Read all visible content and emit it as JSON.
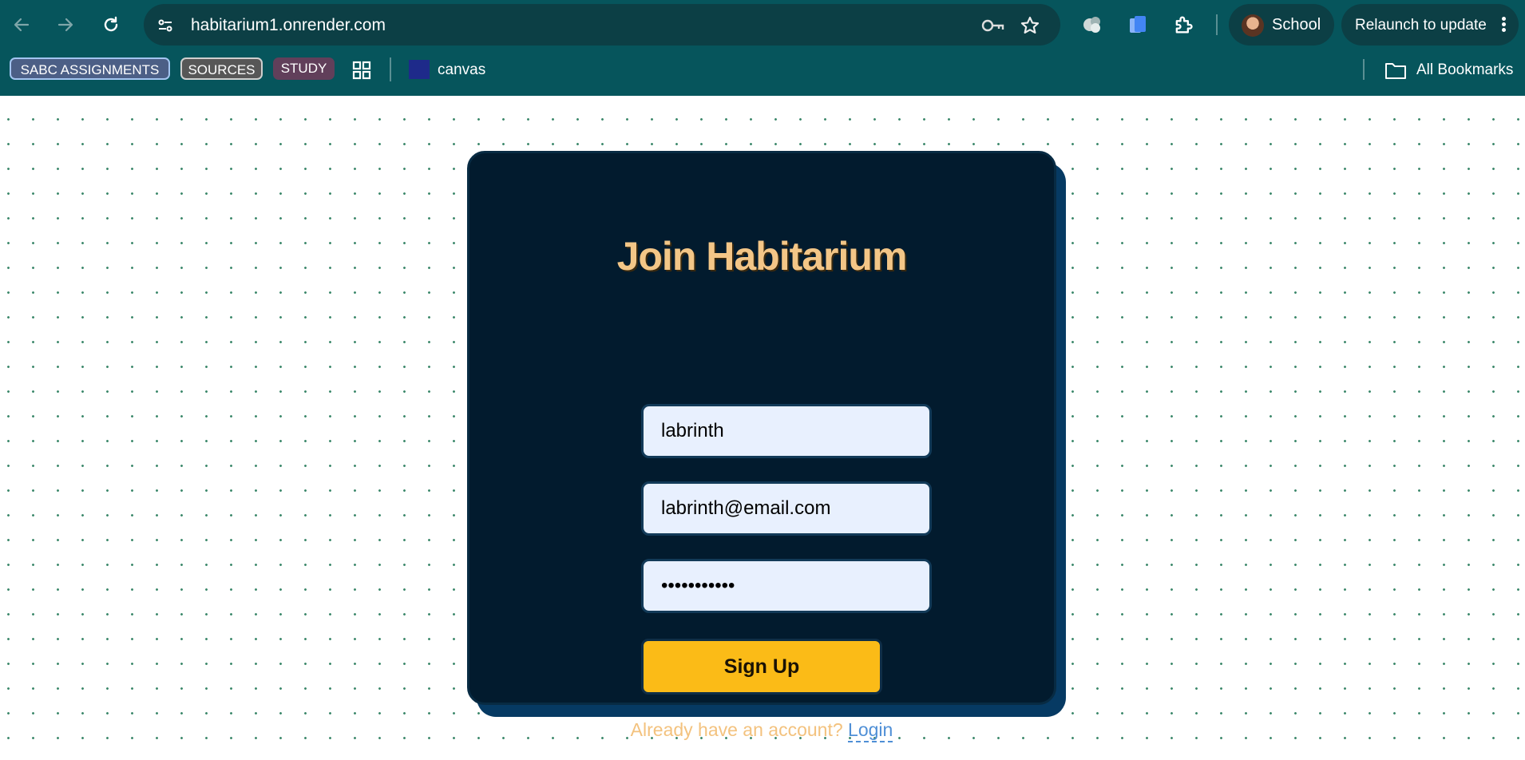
{
  "browser": {
    "url": "habitarium1.onrender.com",
    "profile_label": "School",
    "relaunch_label": "Relaunch to update",
    "icons": [
      "back-arrow-icon",
      "forward-arrow-icon",
      "reload-icon",
      "site-info-icon",
      "key-icon",
      "star-icon",
      "extension-puzzle-icon",
      "clipboard-icon",
      "extensions-icon",
      "more-vert-icon"
    ]
  },
  "bookmarks": {
    "items": [
      {
        "label": "SABC ASSIGNMENTS"
      },
      {
        "label": "SOURCES"
      },
      {
        "label": "STUDY"
      },
      {
        "label": "canvas"
      }
    ],
    "all_label": "All Bookmarks"
  },
  "form": {
    "title": "Join Habitarium",
    "username_value": "labrinth",
    "email_value": "labrinth@email.com",
    "password_value": "•••••••••••",
    "submit_label": "Sign Up",
    "footer_text": "Already have an account?",
    "login_label": "Login"
  },
  "colors": {
    "chrome": "#06555c",
    "card": "#021b2e",
    "title": "#f3c687",
    "button": "#fbbb17",
    "link": "#4f8fd6"
  }
}
